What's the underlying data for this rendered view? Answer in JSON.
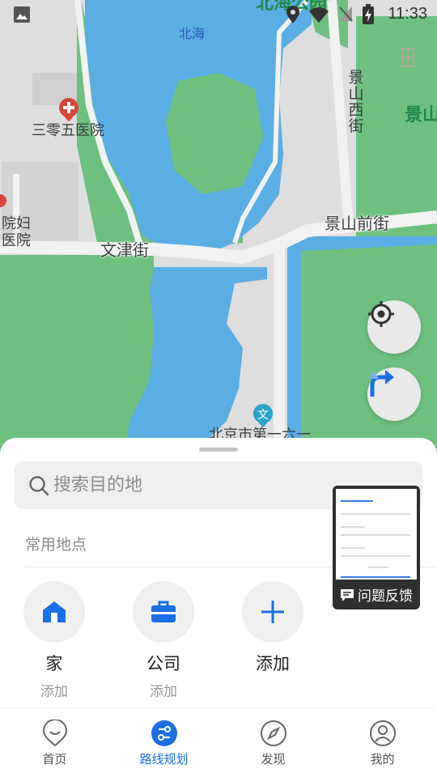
{
  "status_bar": {
    "time": "11:33"
  },
  "map": {
    "labels": {
      "beihai_park": "北海公园",
      "beihai": "北海",
      "jingshan_west": "景山西街",
      "jingshan_park": "景山",
      "hospital_305": "三零五医院",
      "maternity_hospital_1": "院妇",
      "maternity_hospital_2": "医院",
      "jingshan_front": "景山前街",
      "wenjin": "文津街",
      "beijing_school": "北京市第一六一"
    }
  },
  "sheet": {
    "search": {
      "placeholder": "搜索目的地",
      "value": ""
    },
    "common_places_title": "常用地点",
    "places": [
      {
        "name": "家",
        "sub": "添加",
        "icon": "home-icon"
      },
      {
        "name": "公司",
        "sub": "添加",
        "icon": "briefcase-icon"
      },
      {
        "name": "添加",
        "icon": "plus-icon"
      }
    ],
    "feedback_label": "问题反馈"
  },
  "nav": {
    "items": [
      {
        "label": "首页",
        "icon": "home-nav-icon",
        "active": false
      },
      {
        "label": "路线规划",
        "icon": "route-plan-icon",
        "active": true
      },
      {
        "label": "发现",
        "icon": "compass-icon",
        "active": false
      },
      {
        "label": "我的",
        "icon": "profile-icon",
        "active": false
      }
    ]
  },
  "colors": {
    "accent": "#1a6fe6",
    "water": "#5aaee3",
    "park": "#6ec07e",
    "road": "#f2f2f2"
  }
}
